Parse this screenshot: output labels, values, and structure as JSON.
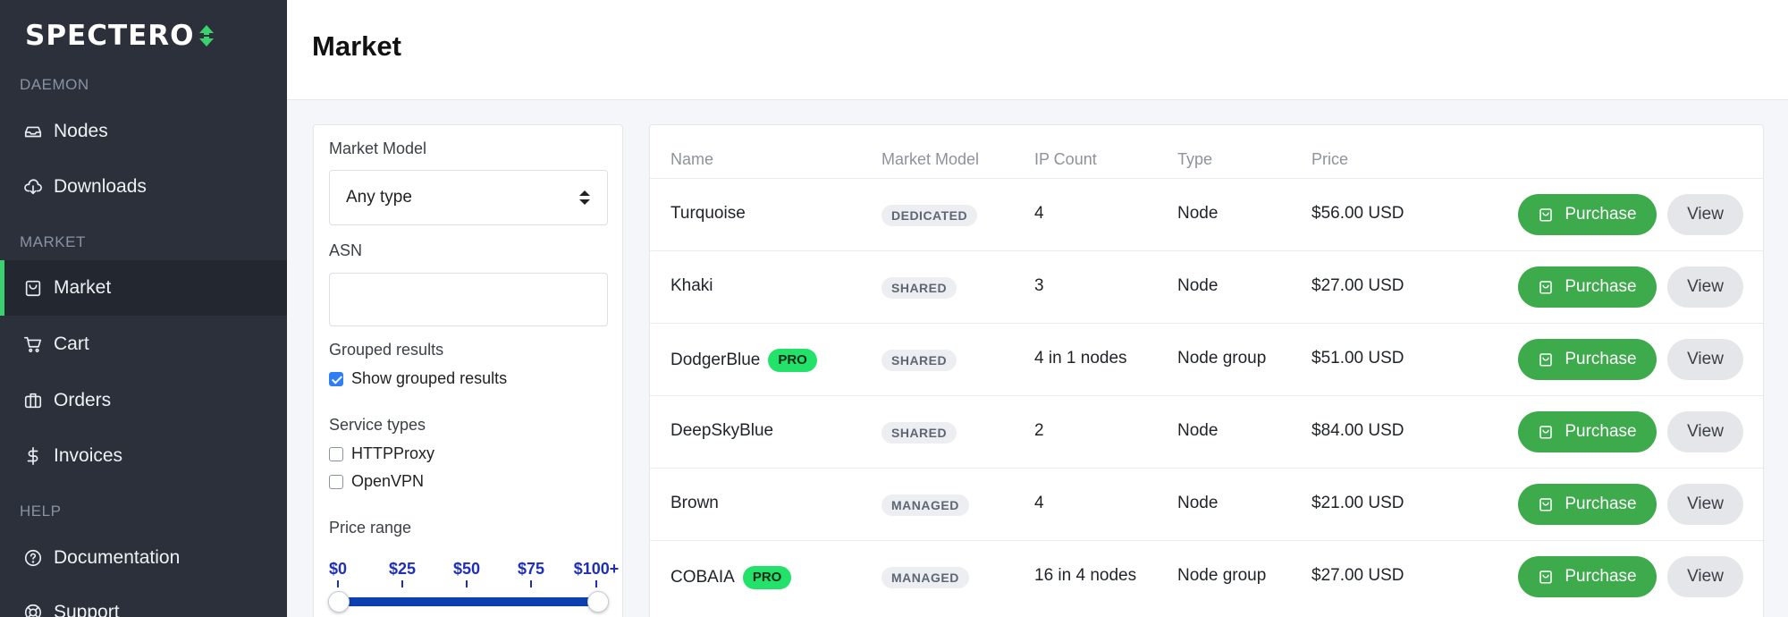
{
  "app": {
    "brand": "SPECTERO",
    "page_title": "Market"
  },
  "colors": {
    "accent": "#3bd16f",
    "purchase": "#3daa4c",
    "pro_badge": "#22e26a",
    "slider": "#0d3fb0",
    "sidebar_bg": "#2b303b"
  },
  "sidebar": {
    "sections": [
      {
        "label": "DAEMON",
        "items": [
          {
            "label": "Nodes",
            "icon": "inbox-icon"
          },
          {
            "label": "Downloads",
            "icon": "cloud-download-icon"
          }
        ]
      },
      {
        "label": "MARKET",
        "items": [
          {
            "label": "Market",
            "icon": "shopping-bag-icon",
            "active": true
          },
          {
            "label": "Cart",
            "icon": "cart-icon"
          },
          {
            "label": "Orders",
            "icon": "briefcase-icon"
          },
          {
            "label": "Invoices",
            "icon": "dollar-icon"
          }
        ]
      },
      {
        "label": "HELP",
        "items": [
          {
            "label": "Documentation",
            "icon": "help-circle-icon"
          },
          {
            "label": "Support",
            "icon": "lifebuoy-icon"
          }
        ]
      }
    ]
  },
  "filters": {
    "market_model_label": "Market Model",
    "market_model_value": "Any type",
    "asn_label": "ASN",
    "asn_value": "",
    "grouped_label": "Grouped results",
    "grouped_checkbox_label": "Show grouped results",
    "grouped_checked": true,
    "service_types_label": "Service types",
    "service_types": [
      {
        "label": "HTTPProxy",
        "checked": false
      },
      {
        "label": "OpenVPN",
        "checked": false
      }
    ],
    "price_range_label": "Price range",
    "price_ticks": [
      "$0",
      "$25",
      "$50",
      "$75",
      "$100+"
    ],
    "price_min": 0,
    "price_max": 100
  },
  "table": {
    "headers": [
      "Name",
      "Market Model",
      "IP Count",
      "Type",
      "Price"
    ],
    "purchase_label": "Purchase",
    "view_label": "View",
    "pro_label": "PRO",
    "rows": [
      {
        "name": "Turquoise",
        "pro": false,
        "model": "DEDICATED",
        "ip_count": "4",
        "type": "Node",
        "price": "$56.00 USD"
      },
      {
        "name": "Khaki",
        "pro": false,
        "model": "SHARED",
        "ip_count": "3",
        "type": "Node",
        "price": "$27.00 USD"
      },
      {
        "name": "DodgerBlue",
        "pro": true,
        "model": "SHARED",
        "ip_count": "4 in 1 nodes",
        "type": "Node group",
        "price": "$51.00 USD"
      },
      {
        "name": "DeepSkyBlue",
        "pro": false,
        "model": "SHARED",
        "ip_count": "2",
        "type": "Node",
        "price": "$84.00 USD"
      },
      {
        "name": "Brown",
        "pro": false,
        "model": "MANAGED",
        "ip_count": "4",
        "type": "Node",
        "price": "$21.00 USD"
      },
      {
        "name": "COBAIA",
        "pro": true,
        "model": "MANAGED",
        "ip_count": "16 in 4 nodes",
        "type": "Node group",
        "price": "$27.00 USD"
      }
    ]
  }
}
